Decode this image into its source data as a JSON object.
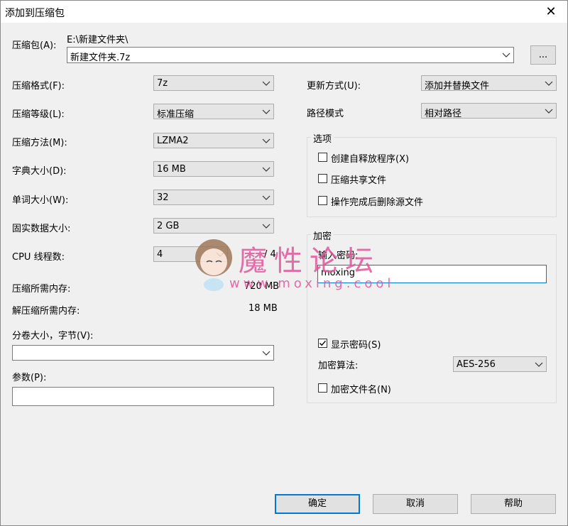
{
  "window": {
    "title": "添加到压缩包",
    "close_glyph": "✕"
  },
  "archive": {
    "label": "压缩包(A):",
    "path": "E:\\新建文件夹\\",
    "value": "新建文件夹.7z",
    "browse_label": "..."
  },
  "left": {
    "format": {
      "label": "压缩格式(F):",
      "value": "7z"
    },
    "level": {
      "label": "压缩等级(L):",
      "value": "标准压缩"
    },
    "method": {
      "label": "压缩方法(M):",
      "value": "LZMA2"
    },
    "dict": {
      "label": "字典大小(D):",
      "value": "16 MB"
    },
    "word": {
      "label": "单词大小(W):",
      "value": "32"
    },
    "solid": {
      "label": "固实数据大小:",
      "value": "2 GB"
    },
    "threads": {
      "label": "CPU 线程数:",
      "value": "4",
      "max": "/ 4"
    },
    "mem_compress": {
      "label": "压缩所需内存:",
      "value": "720 MB"
    },
    "mem_decompress": {
      "label": "解压缩所需内存:",
      "value": "18 MB"
    },
    "volume": {
      "label": "分卷大小，字节(V):",
      "value": ""
    },
    "params": {
      "label": "参数(P):",
      "value": ""
    }
  },
  "right": {
    "update": {
      "label": "更新方式(U):",
      "value": "添加并替换文件"
    },
    "pathmode": {
      "label": "路径模式",
      "value": "相对路径"
    },
    "options": {
      "title": "选项",
      "items": [
        {
          "label": "创建自释放程序(X)",
          "checked": false
        },
        {
          "label": "压缩共享文件",
          "checked": false
        },
        {
          "label": "操作完成后删除源文件",
          "checked": false
        }
      ]
    },
    "encryption": {
      "title": "加密",
      "pw_label": "输入密码:",
      "pw_value": "moxing",
      "show_pw_label": "显示密码(S)",
      "show_pw_checked": true,
      "algo_label": "加密算法:",
      "algo_value": "AES-256",
      "encrypt_names_label": "加密文件名(N)",
      "encrypt_names_checked": false
    }
  },
  "buttons": {
    "ok": "确定",
    "cancel": "取消",
    "help": "帮助"
  },
  "watermark": {
    "title": "魔性论坛",
    "url": "www.moxing.cool"
  },
  "colors": {
    "accent": "#0078d7",
    "watermark": "#e0559a",
    "window_bg": "#f0f0f0"
  },
  "icons": [
    "close-icon",
    "chevron-down-icon",
    "checkbox-icon",
    "check-icon"
  ]
}
